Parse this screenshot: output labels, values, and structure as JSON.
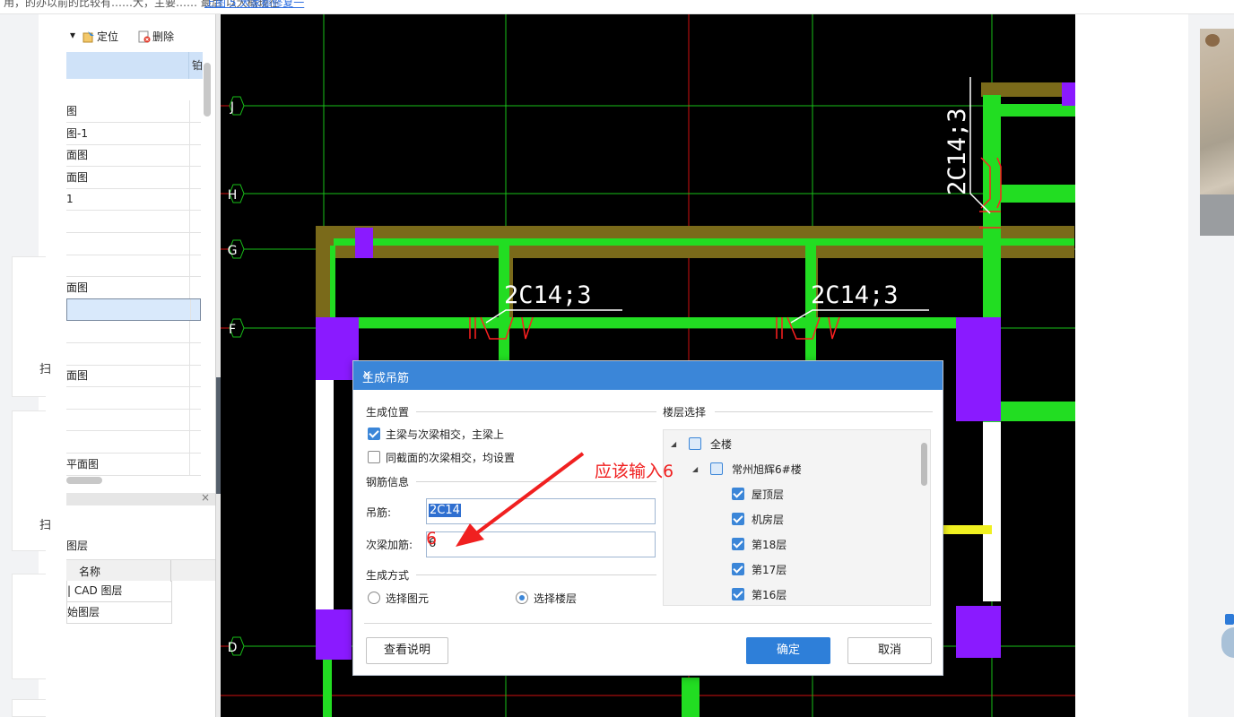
{
  "top_strip": {
    "text": "用，的办以前的比较有……大，主要…… 最后 以大概现在",
    "link": "上图 5 大家都修复一"
  },
  "left_panel": {
    "toolbar": {
      "dropdown": "▾",
      "locate_label": "定位",
      "delete_label": "删除"
    },
    "header_col2": "铂",
    "rows": [
      "图",
      "图-1",
      "面图",
      "面图",
      "1",
      "",
      "",
      "",
      "面图",
      "",
      "",
      "",
      "面图",
      "",
      "",
      "",
      "平面图"
    ],
    "close_label": "×",
    "layer_section_title": "图层",
    "layer_table": {
      "header": "名称",
      "rows": [
        "| CAD 图层",
        "始图层"
      ]
    }
  },
  "cad": {
    "axes": [
      "J",
      "H",
      "G",
      "F",
      "D"
    ],
    "labels": [
      "2C14;3",
      "2C14;3",
      "2C14;3"
    ]
  },
  "dialog": {
    "title": "生成吊筋",
    "close": "×",
    "position_group": "生成位置",
    "option_main_secondary": "主梁与次梁相交，主梁上",
    "option_same_section": "同截面的次梁相交，均设置",
    "rebar_group": "钢筋信息",
    "hanger_label": "吊筋:",
    "hanger_value": "2C14",
    "extra_label": "次梁加筋:",
    "extra_value": "6",
    "method_group": "生成方式",
    "method_element": "选择图元",
    "method_floor": "选择楼层",
    "floor_group": "楼层选择",
    "floor_tree": {
      "all": "全楼",
      "building": "常州旭辉6#楼",
      "floors": [
        "屋顶层",
        "机房层",
        "第18层",
        "第17层",
        "第16层"
      ]
    },
    "help_button": "查看说明",
    "ok_button": "确定",
    "cancel_button": "取消"
  },
  "annotation": {
    "hint": "应该输入6",
    "digit": "6"
  },
  "right_sidebar": {
    "card1_text": "扫",
    "card2_text": "扫"
  },
  "colors": {
    "dialog_title_bar": "#3b86d8",
    "primary_button": "#2e7fd9",
    "annotation_red": "#f02020",
    "cad_background": "#000000",
    "beam_green": "#22dd22",
    "beam_olive": "#7a6a1a",
    "column_purple": "#8a1aff"
  }
}
